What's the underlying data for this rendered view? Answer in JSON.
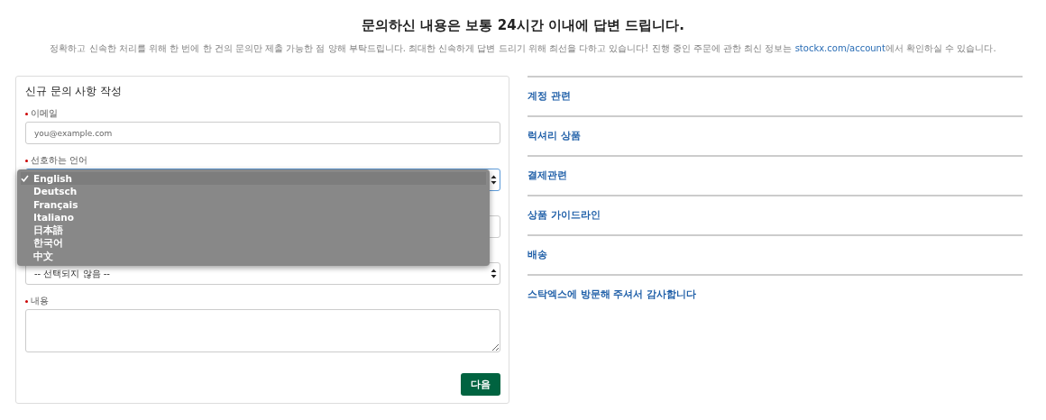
{
  "header": {
    "title": "문의하신 내용은 보통 24시간 이내에 답변 드립니다.",
    "notice": "정확하고 신속한 처리를 위해 한 번에 한 건의 문의만 제출 가능한 점 양해 부탁드립니다. 최대한 신속하게 답변 드리기 위해 최선을 다하고 있습니다! 진행 중인 주문에 관한 최신 정보는 ",
    "notice_link": "stockx.com/account",
    "notice_end": "에서 확인하실 수 있습니다."
  },
  "form": {
    "title": "신규 문의 사항 작성",
    "fields": [
      {
        "kind": "input",
        "label": "이메일",
        "required": true,
        "placeholder": "you@example.com"
      },
      {
        "kind": "select",
        "label": "선호하는 언어",
        "required": true
      },
      {
        "kind": "input"
      },
      {
        "kind": "select",
        "value": "-- 선택되지 않음 --"
      },
      {
        "kind": "textarea",
        "label": "내용",
        "required": true
      }
    ],
    "submit": "다음"
  },
  "dropdown": {
    "options": [
      {
        "label": "English",
        "selected": true
      },
      {
        "label": "Deutsch",
        "selected": false
      },
      {
        "label": "Français",
        "selected": false
      },
      {
        "label": "Italiano",
        "selected": false
      },
      {
        "label": "日本語",
        "selected": false
      },
      {
        "label": "한국어",
        "selected": false
      },
      {
        "label": "中文",
        "selected": false
      }
    ]
  },
  "topics": [
    "계정 관련",
    "럭셔리 상품",
    "결제관련",
    "상품 가이드라인",
    "배송",
    "스탁엑스에 방문해 주셔서 감사합니다"
  ]
}
